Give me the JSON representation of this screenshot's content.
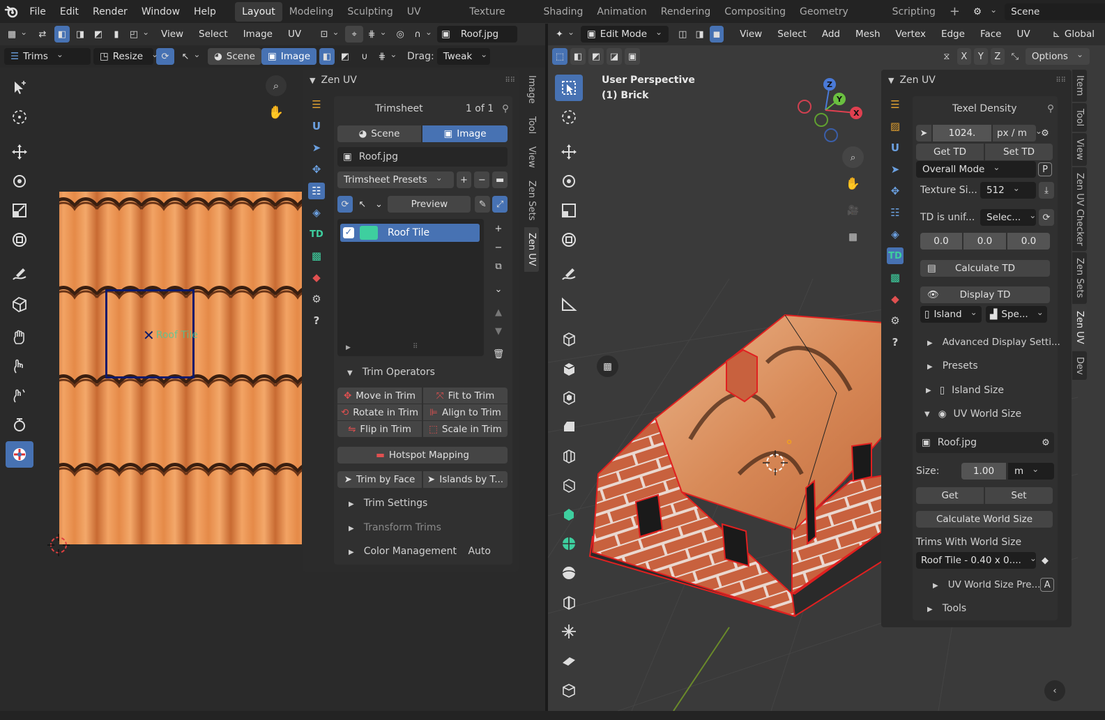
{
  "topbar": {
    "menus": [
      "File",
      "Edit",
      "Render",
      "Window",
      "Help"
    ],
    "workspaces": [
      "Layout",
      "Modeling",
      "Sculpting",
      "UV Editing",
      "Texture Paint",
      "Shading",
      "Animation",
      "Rendering",
      "Compositing",
      "Geometry Nodes",
      "Scripting"
    ],
    "active_workspace": "Layout",
    "scene": "Scene"
  },
  "uv_editor": {
    "header_menus": [
      "View",
      "Select",
      "Image",
      "UV"
    ],
    "image_name": "Roof.jpg",
    "header2": {
      "mode": "Trims",
      "resize": "Resize",
      "scene": "Scene",
      "image": "Image",
      "drag_label": "Drag:",
      "drag_value": "Tweak"
    },
    "trim_overlay_label": "Roof Tile"
  },
  "zen_uv_left": {
    "title": "Zen UV",
    "trimsheet": {
      "title": "Trimsheet",
      "count": "1 of 1",
      "scene": "Scene",
      "image": "Image",
      "image_name": "Roof.jpg",
      "presets": "Trimsheet Presets",
      "preview": "Preview",
      "items": [
        {
          "name": "Roof Tile",
          "color": "#3ecf9f"
        }
      ]
    },
    "trim_operators": {
      "title": "Trim Operators",
      "buttons": [
        "Move in Trim",
        "Fit to Trim",
        "Rotate in Trim",
        "Align to Trim",
        "Flip in Trim",
        "Scale in Trim"
      ],
      "hotspot": "Hotspot Mapping",
      "trim_by_face": "Trim by Face",
      "islands_by": "Islands by T..."
    },
    "sections": [
      {
        "label": "Trim Settings",
        "muted": false,
        "value": ""
      },
      {
        "label": "Transform Trims",
        "muted": true,
        "value": ""
      },
      {
        "label": "Color Management",
        "muted": false,
        "value": "Auto"
      }
    ]
  },
  "vtabs_left": [
    "Image",
    "Tool",
    "View",
    "Zen Sets",
    "Zen UV"
  ],
  "viewport": {
    "header_menus": [
      "View",
      "Select",
      "Add",
      "Mesh",
      "Vertex",
      "Edge",
      "Face",
      "UV"
    ],
    "mode": "Edit Mode",
    "transform": "Global",
    "options": "Options",
    "axes": [
      "X",
      "Y",
      "Z"
    ],
    "overlay_line1": "User Perspective",
    "overlay_line2": "(1) Brick"
  },
  "zen_uv_right": {
    "title": "Zen UV",
    "texel_density": {
      "title": "Texel Density",
      "value": "1024.",
      "unit": "px / m",
      "get": "Get TD",
      "set": "Set TD",
      "mode": "Overall Mode",
      "mode_key": "P",
      "texture_label": "Texture Si...",
      "texture_value": "512",
      "uniform_label": "TD is unif...",
      "uniform_value": "Selec...",
      "vals": [
        "0.0",
        "0.0",
        "0.0"
      ],
      "calculate": "Calculate TD",
      "display": "Display TD",
      "island": "Island",
      "spe": "Spe..."
    },
    "collapsed": [
      "Advanced Display Setti...",
      "Presets",
      "Island Size"
    ],
    "uv_world_size": {
      "title": "UV World Size",
      "image": "Roof.jpg",
      "size_label": "Size:",
      "size_value": "1.00",
      "size_unit": "m",
      "get": "Get",
      "set": "Set",
      "calculate": "Calculate World Size",
      "trims_label": "Trims With World Size",
      "trim_value": "Roof Tile - 0.40 x 0....",
      "presets": "UV World Size Pre...",
      "presets_key": "A",
      "tools": "Tools"
    }
  },
  "vtabs_right": [
    "Item",
    "Tool",
    "View",
    "Zen UV Checker",
    "Zen Sets",
    "Zen UV",
    "Dev"
  ],
  "colors": {
    "accent": "#4772b3",
    "mesh_edge": "#e02020",
    "trim_box": "#0a1a6a"
  }
}
